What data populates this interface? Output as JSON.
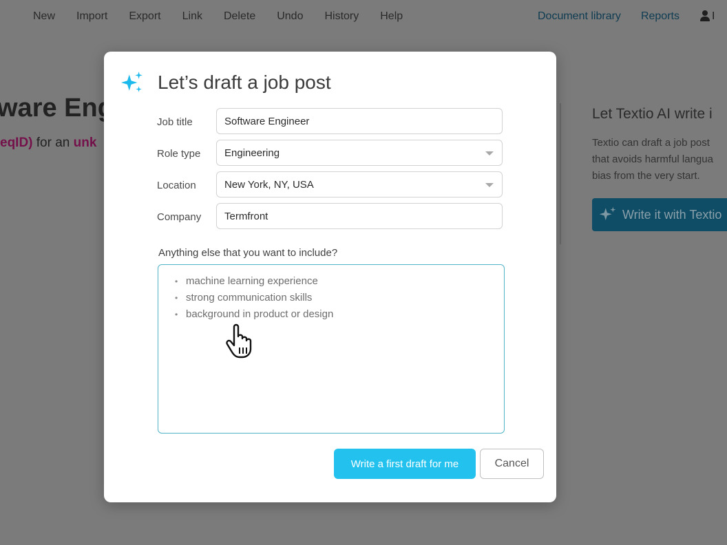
{
  "menu": {
    "items": [
      "New",
      "Import",
      "Export",
      "Link",
      "Delete",
      "Undo",
      "History",
      "Help"
    ]
  },
  "nav": {
    "document_library": "Document library",
    "reports": "Reports",
    "user_initial": "I"
  },
  "background": {
    "title": "ware Eng",
    "subtitle_pink_1": "eqID)",
    "subtitle_mid": " for an ",
    "subtitle_pink_2": "unk"
  },
  "side_panel": {
    "title": "Let Textio AI write i",
    "text_lines": [
      "Textio can draft a job post",
      "that avoids harmful langua",
      "bias from the very start."
    ],
    "button_label": "Write it with Textio"
  },
  "modal": {
    "title": "Let’s draft a job post",
    "fields": {
      "job_title": {
        "label": "Job title",
        "value": "Software Engineer"
      },
      "role_type": {
        "label": "Role type",
        "value": "Engineering"
      },
      "location": {
        "label": "Location",
        "value": "New York, NY, USA"
      },
      "company": {
        "label": "Company",
        "value": "Termfront"
      }
    },
    "extra_label": "Anything else that you want to include?",
    "bullets": [
      "machine learning experience",
      "strong communication skills",
      "background in product or design"
    ],
    "primary_button": "Write a first draft for me",
    "cancel_button": "Cancel"
  },
  "colors": {
    "accent": "#22c1ee",
    "sparkle": "#1cb9ec",
    "dark_teal": "#0f4c65",
    "pink": "#74104a"
  }
}
